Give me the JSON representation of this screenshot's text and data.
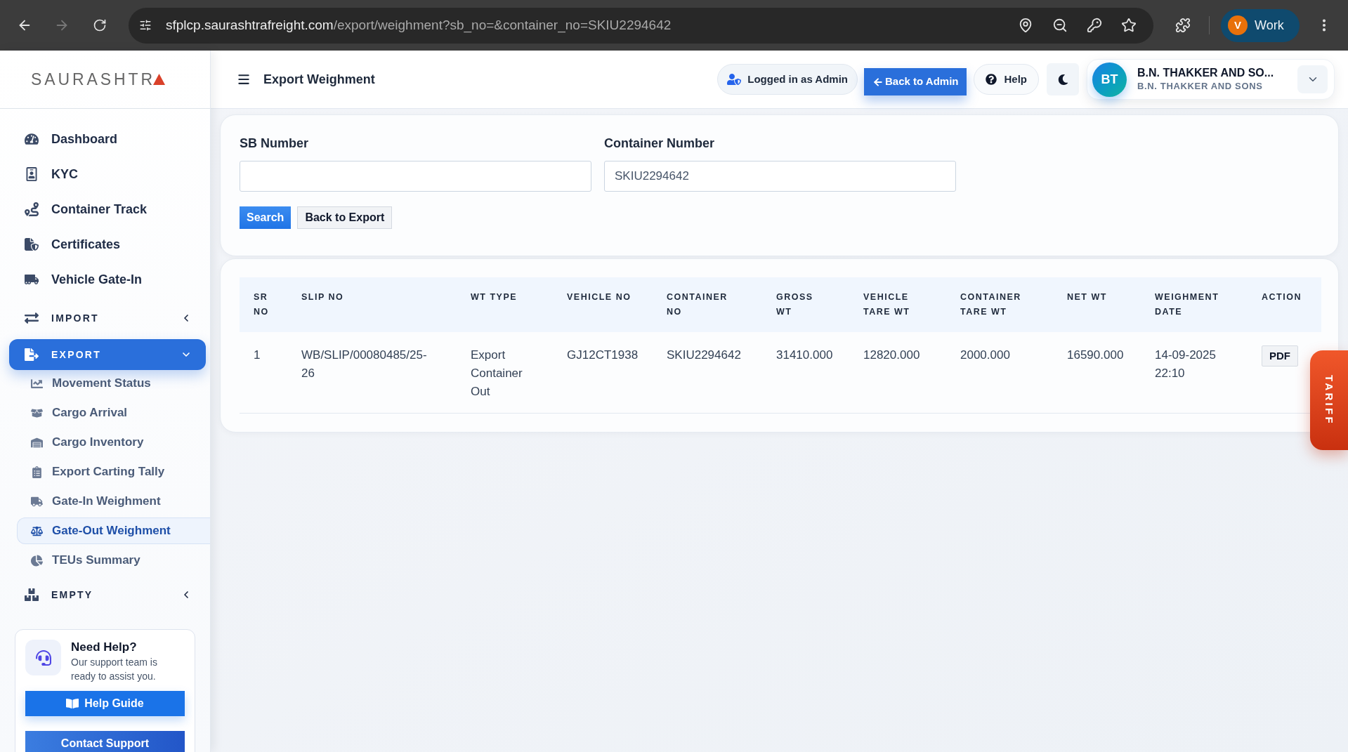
{
  "browser": {
    "navigation": {
      "forward_disabled": true
    },
    "address": {
      "host": "sfplcp.saurashtrafreight.com",
      "path": "/export/weighment?sb_no=&container_no=SKIU2294642"
    },
    "profile": {
      "initial": "V",
      "label": "Work"
    }
  },
  "sidebar": {
    "logo": "SAURASHTR",
    "items": [
      {
        "kind": "link",
        "label": "Dashboard",
        "selected": false
      },
      {
        "kind": "link",
        "label": "KYC",
        "selected": false
      },
      {
        "kind": "link",
        "label": "Container Track",
        "selected": false
      },
      {
        "kind": "link",
        "label": "Certificates",
        "selected": false
      },
      {
        "kind": "link",
        "label": "Vehicle Gate-In",
        "selected": false
      },
      {
        "kind": "section",
        "label": "IMPORT",
        "selected": false,
        "expanded": false
      },
      {
        "kind": "section",
        "label": "EXPORT",
        "selected": true,
        "expanded": true,
        "children": [
          {
            "label": "Movement Status",
            "selected": false
          },
          {
            "label": "Cargo Arrival",
            "selected": false
          },
          {
            "label": "Cargo Inventory",
            "selected": false
          },
          {
            "label": "Export Carting Tally",
            "selected": false
          },
          {
            "label": "Gate-In Weighment",
            "selected": false
          },
          {
            "label": "Gate-Out Weighment",
            "selected": true
          },
          {
            "label": "TEUs Summary",
            "selected": false
          }
        ]
      },
      {
        "kind": "section",
        "label": "EMPTY",
        "selected": false,
        "expanded": false
      }
    ],
    "help_card": {
      "title": "Need Help?",
      "text": "Our support team is ready to assist you.",
      "buttons": [
        {
          "kind": "guide",
          "label": "Help Guide"
        },
        {
          "kind": "contact",
          "label": "Contact Support"
        }
      ]
    }
  },
  "header": {
    "title": "Export Weighment",
    "login_badge": "Logged in as Admin",
    "back_button": "Back to Admin",
    "help_button": "Help",
    "user": {
      "initials": "BT",
      "name": "B.N. THAKKER AND SO...",
      "company": "B.N. THAKKER AND SONS"
    }
  },
  "search_form": {
    "fields": [
      {
        "label": "SB Number"
      },
      {
        "label": "Container Number",
        "value": "SKIU2294642"
      }
    ],
    "buttons": [
      {
        "kind": "primary",
        "label": "Search"
      },
      {
        "kind": "secondary",
        "label": "Back to Export"
      }
    ]
  },
  "table": {
    "columns": [
      "SR NO",
      "SLIP NO",
      "WT TYPE",
      "VEHICLE NO",
      "CONTAINER NO",
      "GROSS WT",
      "VEHICLE TARE WT",
      "CONTAINER TARE WT",
      "NET WT",
      "WEIGHMENT DATE",
      "ACTION"
    ],
    "rows": [
      {
        "cells": [
          "1",
          "WB/SLIP/00080485/25-26",
          "Export Container Out",
          "GJ12CT1938",
          "SKIU2294642",
          "31410.000",
          "12820.000",
          "2000.000",
          "16590.000",
          "14-09-2025 22:10"
        ],
        "action": "PDF"
      }
    ]
  },
  "tariff_tab": "TARIFF"
}
